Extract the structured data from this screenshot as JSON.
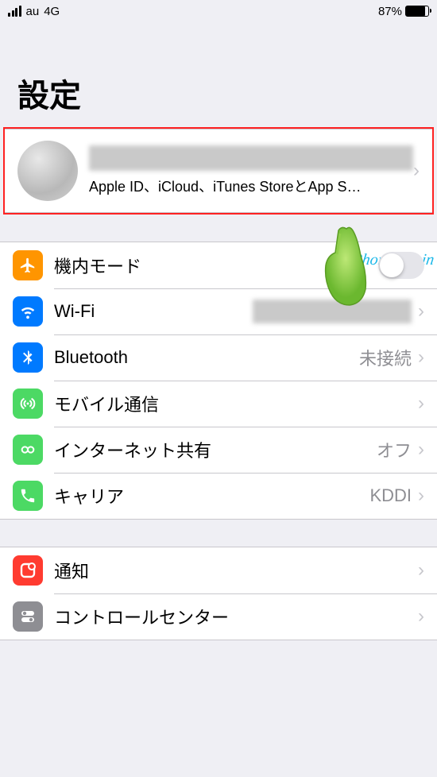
{
  "status": {
    "carrier": "au",
    "network": "4G",
    "battery_pct": "87%"
  },
  "header": {
    "title": "設定"
  },
  "profile": {
    "subtitle": "Apple ID、iCloud、iTunes StoreとApp S…"
  },
  "rows": {
    "airplane": {
      "label": "機内モード"
    },
    "wifi": {
      "label": "Wi-Fi"
    },
    "bluetooth": {
      "label": "Bluetooth",
      "detail": "未接続"
    },
    "cellular": {
      "label": "モバイル通信"
    },
    "hotspot": {
      "label": "インターネット共有",
      "detail": "オフ"
    },
    "carrier": {
      "label": "キャリア",
      "detail": "KDDI"
    },
    "notifications": {
      "label": "通知"
    },
    "control_center": {
      "label": "コントロールセンター"
    }
  },
  "watermark": "iPhone Begin",
  "colors": {
    "airplane": "#ff9500",
    "wifi": "#007aff",
    "bluetooth": "#007aff",
    "cellular": "#4cd964",
    "hotspot": "#4cd964",
    "carrier": "#4cd964",
    "notifications": "#ff3b30",
    "control_center": "#8e8e93"
  }
}
